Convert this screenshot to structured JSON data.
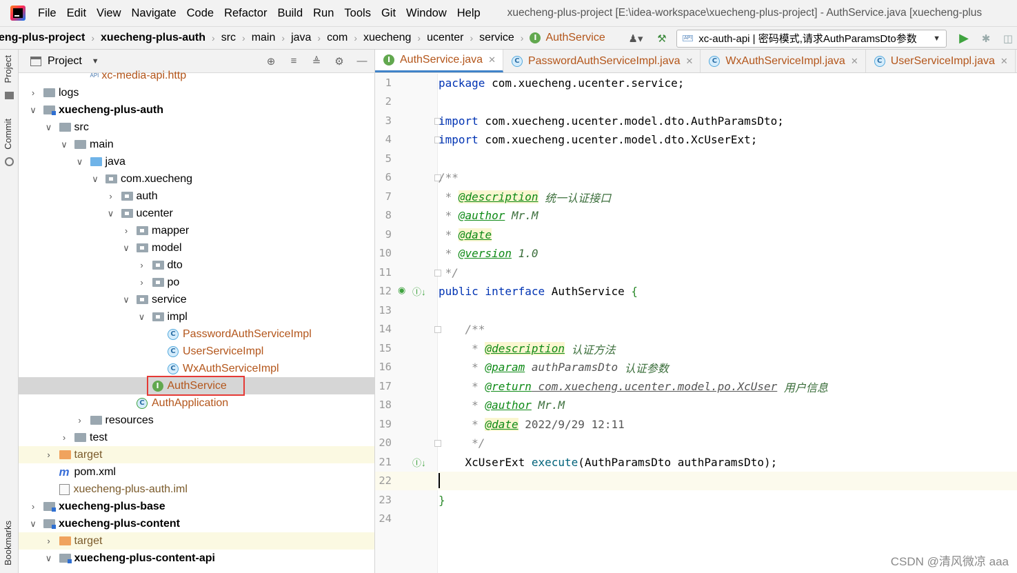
{
  "menubar": {
    "items": [
      "File",
      "Edit",
      "View",
      "Navigate",
      "Code",
      "Refactor",
      "Build",
      "Run",
      "Tools",
      "Git",
      "Window",
      "Help"
    ],
    "window_title": "xuecheng-plus-project [E:\\idea-workspace\\xuecheng-plus-project] - AuthService.java [xuecheng-plus"
  },
  "navbar": {
    "crumbs": [
      "eng-plus-project",
      "xuecheng-plus-auth",
      "src",
      "main",
      "java",
      "com",
      "xuecheng",
      "ucenter",
      "service",
      "AuthService"
    ],
    "run_config": "xc-auth-api | 密码模式,请求AuthParamsDto参数",
    "api_badge": "API"
  },
  "stripe": {
    "project": "Project",
    "commit": "Commit",
    "bookmarks": "Bookmarks"
  },
  "project_panel": {
    "title": "Project",
    "tree": [
      {
        "label": "xc-media-api.http",
        "kind": "api-file",
        "depth": 4
      },
      {
        "label": "logs",
        "kind": "folder",
        "depth": 1,
        "arrow": ">"
      },
      {
        "label": "xuecheng-plus-auth",
        "kind": "module",
        "depth": 1,
        "arrow": "v",
        "bold": true
      },
      {
        "label": "src",
        "kind": "folder",
        "depth": 2,
        "arrow": "v"
      },
      {
        "label": "main",
        "kind": "folder",
        "depth": 3,
        "arrow": "v"
      },
      {
        "label": "java",
        "kind": "src",
        "depth": 4,
        "arrow": "v"
      },
      {
        "label": "com.xuecheng",
        "kind": "pkg",
        "depth": 5,
        "arrow": "v"
      },
      {
        "label": "auth",
        "kind": "pkg",
        "depth": 6,
        "arrow": ">"
      },
      {
        "label": "ucenter",
        "kind": "pkg",
        "depth": 6,
        "arrow": "v"
      },
      {
        "label": "mapper",
        "kind": "pkg",
        "depth": 7,
        "arrow": ">"
      },
      {
        "label": "model",
        "kind": "pkg",
        "depth": 7,
        "arrow": "v"
      },
      {
        "label": "dto",
        "kind": "pkg",
        "depth": 8,
        "arrow": ">"
      },
      {
        "label": "po",
        "kind": "pkg",
        "depth": 8,
        "arrow": ">"
      },
      {
        "label": "service",
        "kind": "pkg",
        "depth": 7,
        "arrow": "v"
      },
      {
        "label": "impl",
        "kind": "pkg",
        "depth": 8,
        "arrow": "v"
      },
      {
        "label": "PasswordAuthServiceImpl",
        "kind": "class",
        "depth": 9
      },
      {
        "label": "UserServiceImpl",
        "kind": "class",
        "depth": 9
      },
      {
        "label": "WxAuthServiceImpl",
        "kind": "class",
        "depth": 9
      },
      {
        "label": "AuthService",
        "kind": "interface",
        "depth": 8,
        "selected": true
      },
      {
        "label": "AuthApplication",
        "kind": "app",
        "depth": 7
      },
      {
        "label": "resources",
        "kind": "folder",
        "depth": 4,
        "arrow": ">"
      },
      {
        "label": "test",
        "kind": "folder",
        "depth": 3,
        "arrow": ">"
      },
      {
        "label": "target",
        "kind": "target",
        "depth": 2,
        "arrow": ">",
        "yellow": true
      },
      {
        "label": "pom.xml",
        "kind": "maven",
        "depth": 2
      },
      {
        "label": "xuecheng-plus-auth.iml",
        "kind": "file",
        "depth": 2
      },
      {
        "label": "xuecheng-plus-base",
        "kind": "module",
        "depth": 1,
        "arrow": ">",
        "bold": true
      },
      {
        "label": "xuecheng-plus-content",
        "kind": "module",
        "depth": 1,
        "arrow": "v",
        "bold": true
      },
      {
        "label": "target",
        "kind": "target",
        "depth": 2,
        "arrow": ">",
        "yellow": true
      },
      {
        "label": "xuecheng-plus-content-api",
        "kind": "module",
        "depth": 2,
        "arrow": "v",
        "bold": true
      }
    ]
  },
  "editor": {
    "tabs": [
      {
        "label": "AuthService.java",
        "icon": "I",
        "active": true
      },
      {
        "label": "PasswordAuthServiceImpl.java",
        "icon": "C"
      },
      {
        "label": "WxAuthServiceImpl.java",
        "icon": "C"
      },
      {
        "label": "UserServiceImpl.java",
        "icon": "C"
      }
    ],
    "line_numbers": [
      "1",
      "2",
      "3",
      "4",
      "5",
      "6",
      "7",
      "8",
      "9",
      "10",
      "11",
      "12",
      "13",
      "14",
      "15",
      "16",
      "17",
      "18",
      "19",
      "20",
      "21",
      "22",
      "23",
      "24"
    ],
    "code": {
      "l1_kw": "package",
      "l1_rest": " com.xuecheng.ucenter.service;",
      "l3_kw": "import",
      "l3_rest": " com.xuecheng.ucenter.model.dto.AuthParamsDto;",
      "l4_kw": "import",
      "l4_rest": " com.xuecheng.ucenter.model.dto.XcUserExt;",
      "l6": "/**",
      "l7_tag": "@description",
      "l7_text": " 统一认证接口",
      "l8_tag": "@author",
      "l8_text": " Mr.M",
      "l9_tag": "@date",
      "l10_tag": "@version",
      "l10_text": " 1.0",
      "l11": " */",
      "l12_kw": "public interface",
      "l12_rest": " AuthService ",
      "l12_brace": "{",
      "l14": "/**",
      "l15_tag": "@description",
      "l15_text": " 认证方法",
      "l16_tag": "@param",
      "l16_name": " authParamsDto",
      "l16_text": " 认证参数",
      "l17_tag": "@return",
      "l17_ref": " com.xuecheng.ucenter.model.po.XcUser",
      "l17_text": " 用户信息",
      "l18_tag": "@author",
      "l18_text": " Mr.M",
      "l19_tag": "@date",
      "l19_text": " 2022/9/29 12:11",
      "l20": " */",
      "l21_type": "XcUserExt ",
      "l21_fn": "execute",
      "l21_args": "(AuthParamsDto authParamsDto);",
      "l23": "}"
    }
  },
  "watermark": "CSDN @清风微凉 aaa"
}
